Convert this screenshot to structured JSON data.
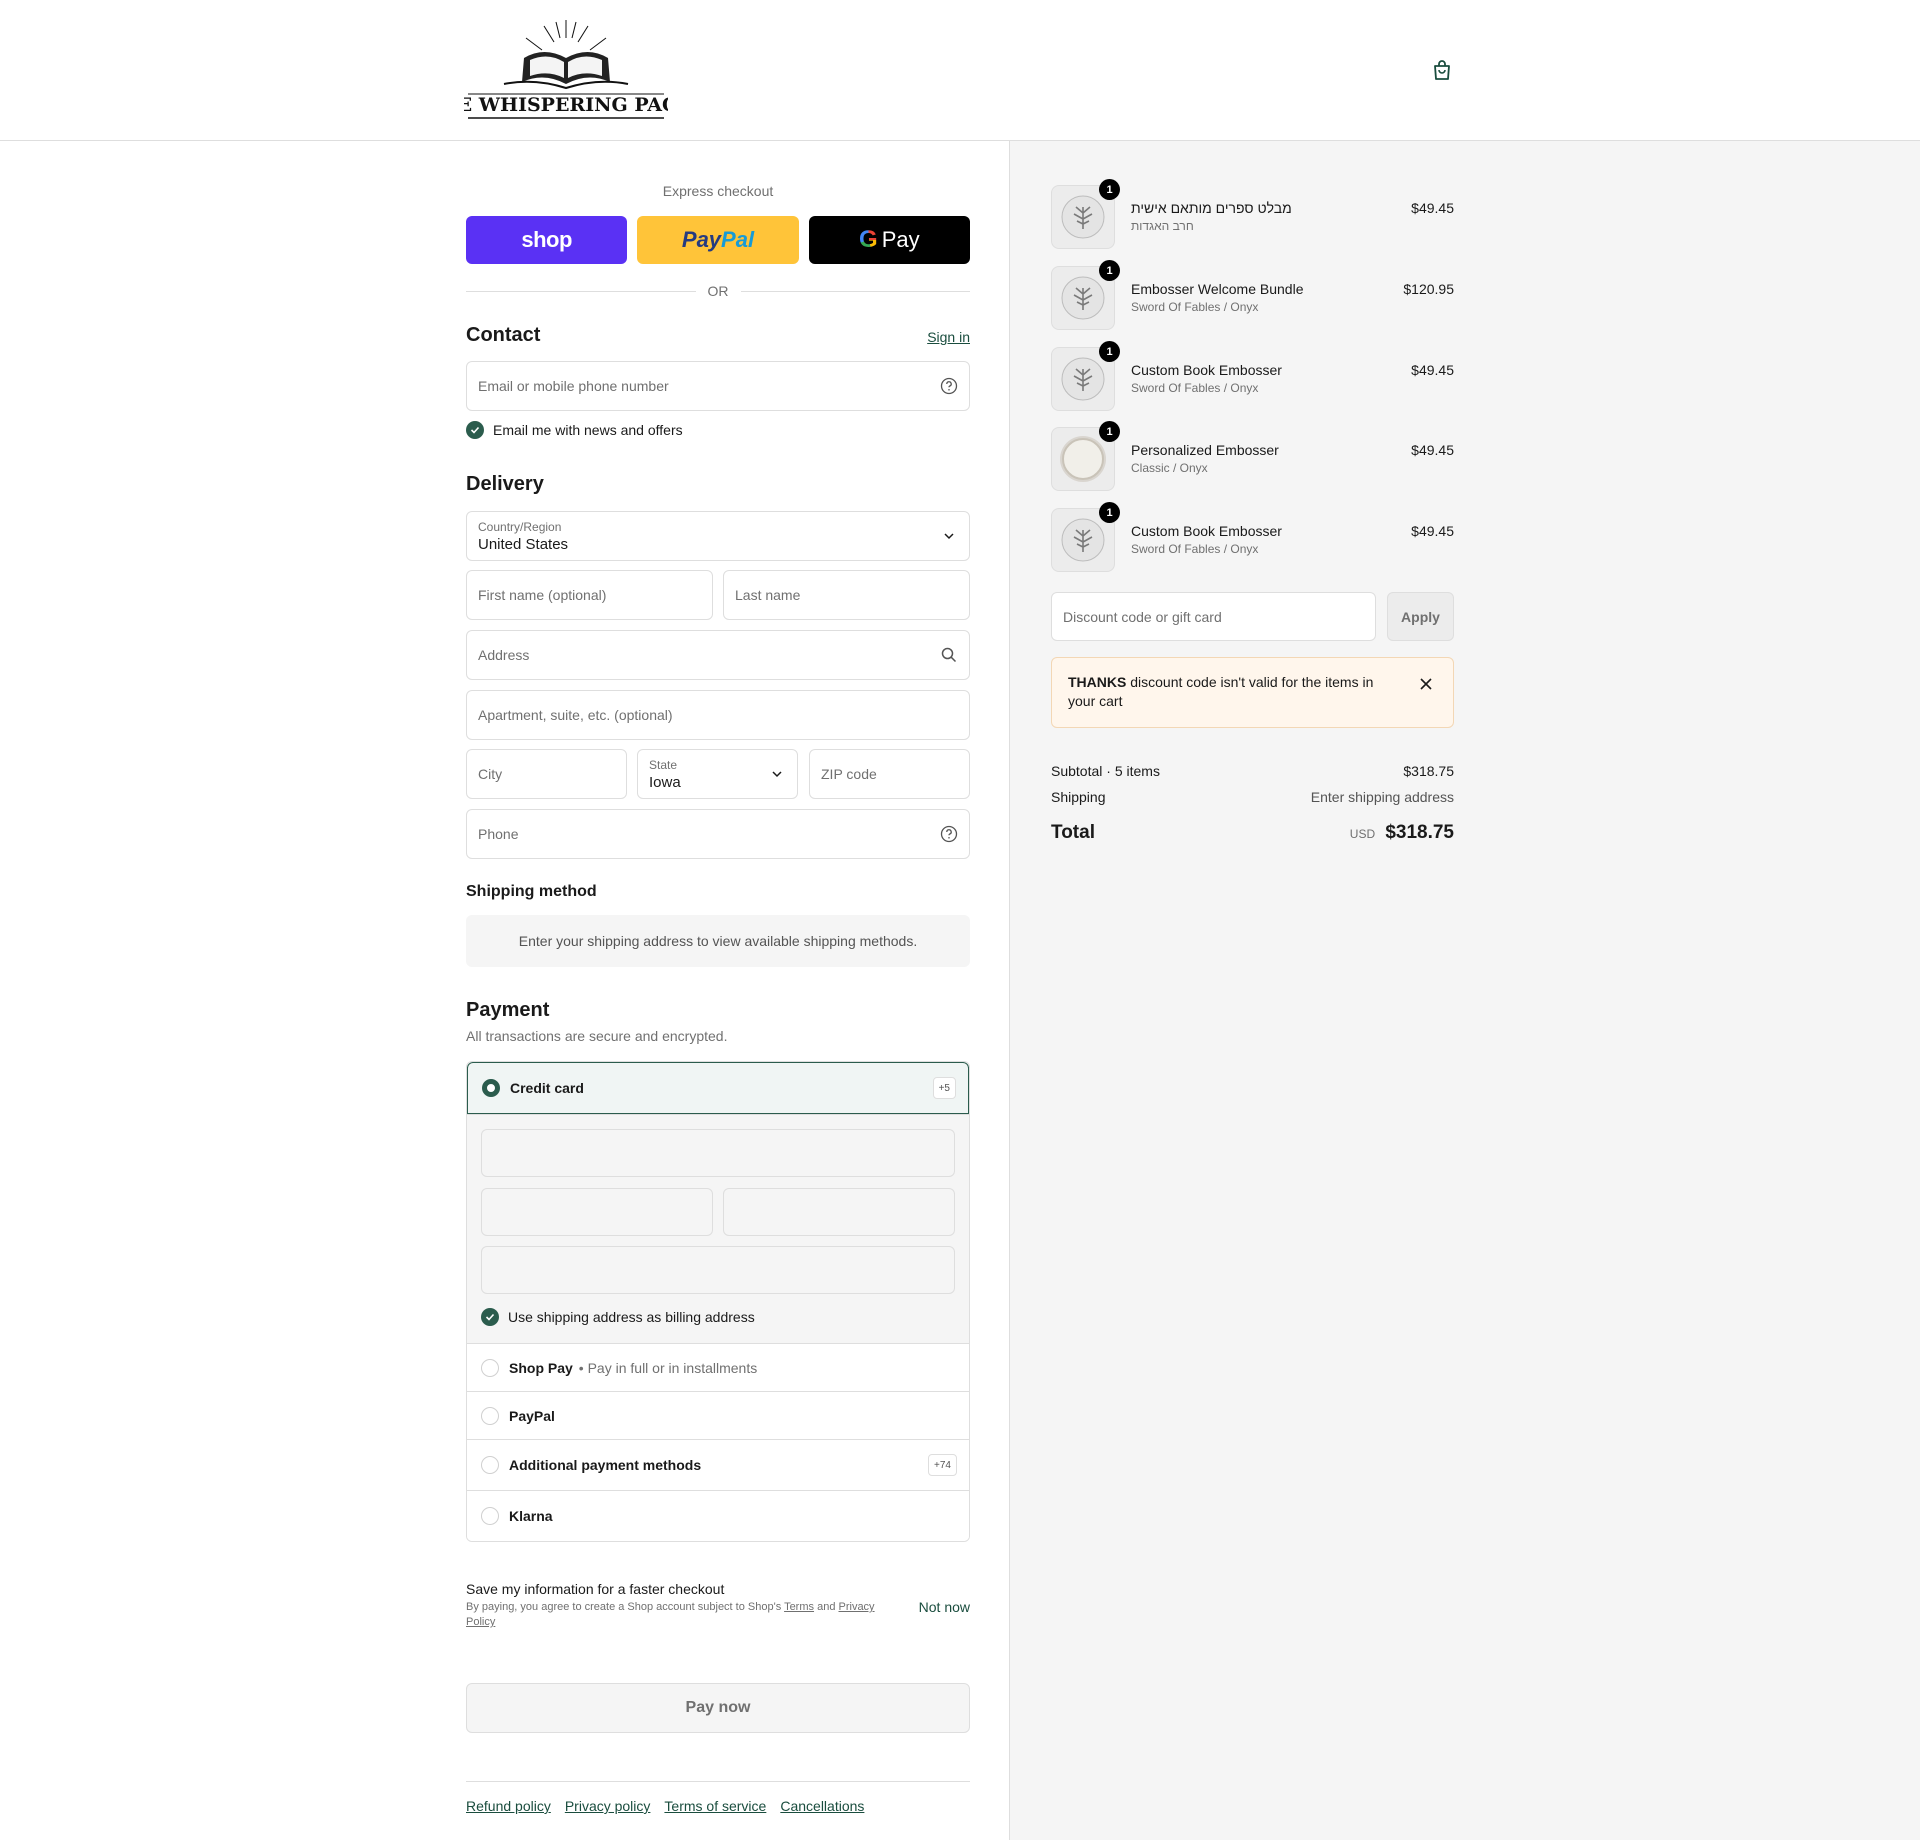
{
  "header": {
    "logo_text": "THE WHISPERING PAGES",
    "cart_icon": "shopping-bag-icon"
  },
  "express": {
    "label": "Express checkout",
    "shop_label": "shop",
    "paypal_label_1": "Pay",
    "paypal_label_2": "Pal",
    "gpay_label": "Pay",
    "or_label": "OR"
  },
  "contact": {
    "title": "Contact",
    "sign_in": "Sign in",
    "email_placeholder": "Email or mobile phone number",
    "newsletter_label": "Email me with news and offers",
    "newsletter_checked": true
  },
  "delivery": {
    "title": "Delivery",
    "country_label": "Country/Region",
    "country_value": "United States",
    "first_name_placeholder": "First name (optional)",
    "last_name_placeholder": "Last name",
    "address_placeholder": "Address",
    "apartment_placeholder": "Apartment, suite, etc. (optional)",
    "city_placeholder": "City",
    "state_label": "State",
    "state_value": "Iowa",
    "zip_placeholder": "ZIP code",
    "phone_placeholder": "Phone"
  },
  "shipping_method": {
    "title": "Shipping method",
    "info": "Enter your shipping address to view available shipping methods."
  },
  "payment": {
    "title": "Payment",
    "subtitle": "All transactions are secure and encrypted.",
    "credit_card_label": "Credit card",
    "credit_card_badge": "+5",
    "billing_label": "Use shipping address as billing address",
    "billing_checked": true,
    "shop_pay_label": "Shop Pay",
    "shop_pay_sub": "• Pay in full or in installments",
    "paypal_label": "PayPal",
    "additional_label": "Additional payment methods",
    "additional_badge": "+74",
    "klarna_label": "Klarna"
  },
  "save_info": {
    "title": "Save my information for a faster checkout",
    "terms_prefix": "By paying, you agree to create a Shop account subject to Shop's",
    "terms_link": "Terms",
    "terms_and": "and",
    "privacy_link": "Privacy Policy",
    "not_now": "Not now"
  },
  "pay_now_label": "Pay now",
  "footer": {
    "links": [
      "Refund policy",
      "Privacy policy",
      "Terms of service",
      "Cancellations"
    ]
  },
  "cart": {
    "items": [
      {
        "name": "מבלט ספרים מותאם אישית",
        "variant": "חרב האגדות",
        "price": "$49.45",
        "qty": "1",
        "thumb": "tree-seal-icon"
      },
      {
        "name": "Embosser Welcome Bundle",
        "variant": "Sword Of Fables / Onyx",
        "price": "$120.95",
        "qty": "1",
        "thumb": "tree-seal-icon"
      },
      {
        "name": "Custom Book Embosser",
        "variant": "Sword Of Fables / Onyx",
        "price": "$49.45",
        "qty": "1",
        "thumb": "tree-seal-icon"
      },
      {
        "name": "Personalized Embosser",
        "variant": "Classic / Onyx",
        "price": "$49.45",
        "qty": "1",
        "thumb": "blank-seal-icon"
      },
      {
        "name": "Custom Book Embosser",
        "variant": "Sword Of Fables / Onyx",
        "price": "$49.45",
        "qty": "1",
        "thumb": "tree-seal-icon"
      }
    ],
    "discount_placeholder": "Discount code or gift card",
    "apply_label": "Apply",
    "alert_code": "THANKS",
    "alert_text": "discount code isn't valid for the items in your cart",
    "subtotal_label": "Subtotal · 5 items",
    "subtotal_value": "$318.75",
    "shipping_label": "Shipping",
    "shipping_value": "Enter shipping address",
    "total_label": "Total",
    "total_currency": "USD",
    "total_value": "$318.75"
  },
  "colors": {
    "accent": "#2b5c4d",
    "shop_purple": "#5a31f4",
    "paypal_yellow": "#ffc439",
    "summary_bg": "#f5f5f5"
  }
}
